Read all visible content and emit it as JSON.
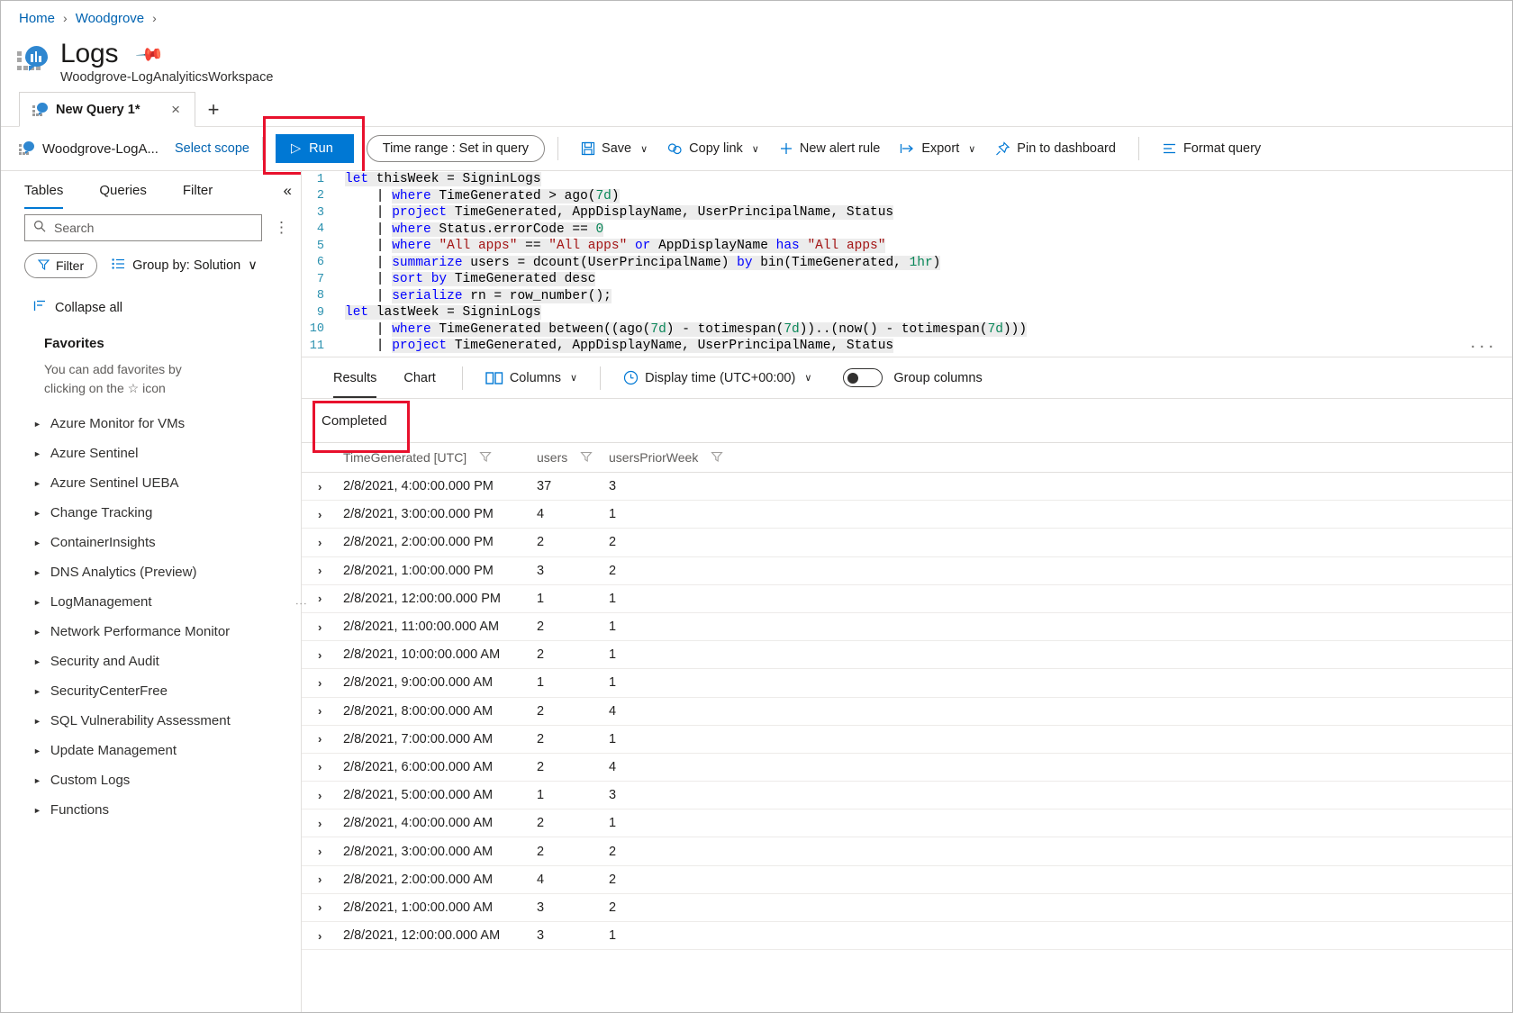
{
  "breadcrumb": {
    "home": "Home",
    "workspace": "Woodgrove",
    "sep": "›"
  },
  "header": {
    "title": "Logs",
    "subtitle": "Woodgrove-LogAnalyiticsWorkspace",
    "pin_icon": "pin-icon"
  },
  "tabs": {
    "query_tab_label": "New Query 1*",
    "close_label": "×",
    "add_label": "+"
  },
  "commandbar": {
    "scope_name": "Woodgrove-LogA...",
    "select_scope": "Select scope",
    "run_label": "Run",
    "run_icon": "play-icon",
    "time_range": "Time range :  Set in query",
    "save": "Save",
    "copy_link": "Copy link",
    "new_alert_rule": "New alert rule",
    "export": "Export",
    "pin_to_dashboard": "Pin to dashboard",
    "format_query": "Format query",
    "chevron": "∨"
  },
  "sidebar": {
    "tabs": [
      {
        "label": "Tables",
        "active": true
      },
      {
        "label": "Queries",
        "active": false
      },
      {
        "label": "Filter",
        "active": false
      }
    ],
    "collapse_chevron": "«",
    "search_placeholder": "Search",
    "filter_label": "Filter",
    "group_by_label": "Group by: Solution",
    "collapse_all": "Collapse all",
    "favorites_heading": "Favorites",
    "favorites_hint_1": "You can add favorites by clicking on",
    "favorites_hint_2": "the",
    "favorites_hint_3": "icon",
    "star_glyph": "☆",
    "solutions": [
      "Azure Monitor for VMs",
      "Azure Sentinel",
      "Azure Sentinel UEBA",
      "Change Tracking",
      "ContainerInsights",
      "DNS Analytics (Preview)",
      "LogManagement",
      "Network Performance Monitor",
      "Security and Audit",
      "SecurityCenterFree",
      "SQL Vulnerability Assessment",
      "Update Management",
      "Custom Logs",
      "Functions"
    ]
  },
  "editor": {
    "ellipsis": "···",
    "lines": [
      {
        "n": "1",
        "text": "let thisWeek = SigninLogs"
      },
      {
        "n": "2",
        "text": "    | where TimeGenerated > ago(7d)"
      },
      {
        "n": "3",
        "text": "    | project TimeGenerated, AppDisplayName, UserPrincipalName, Status"
      },
      {
        "n": "4",
        "text": "    | where Status.errorCode == 0"
      },
      {
        "n": "5",
        "text": "    | where \"All apps\" == \"All apps\" or AppDisplayName has \"All apps\""
      },
      {
        "n": "6",
        "text": "    | summarize users = dcount(UserPrincipalName) by bin(TimeGenerated, 1hr)"
      },
      {
        "n": "7",
        "text": "    | sort by TimeGenerated desc"
      },
      {
        "n": "8",
        "text": "    | serialize rn = row_number();"
      },
      {
        "n": "9",
        "text": "let lastWeek = SigninLogs"
      },
      {
        "n": "10",
        "text": "    | where TimeGenerated between((ago(7d) - totimespan(7d))..(now() - totimespan(7d)))"
      },
      {
        "n": "11",
        "text": "    | project TimeGenerated, AppDisplayName, UserPrincipalName, Status"
      }
    ]
  },
  "results": {
    "tab_results": "Results",
    "tab_chart": "Chart",
    "columns_label": "Columns",
    "display_time_label": "Display time (UTC+00:00)",
    "group_columns_label": "Group columns",
    "chevron": "∨",
    "status": "Completed",
    "columns": [
      "TimeGenerated [UTC]",
      "users",
      "usersPriorWeek"
    ],
    "rows": [
      {
        "time": "2/8/2021, 4:00:00.000 PM",
        "users": "37",
        "prior": "3"
      },
      {
        "time": "2/8/2021, 3:00:00.000 PM",
        "users": "4",
        "prior": "1"
      },
      {
        "time": "2/8/2021, 2:00:00.000 PM",
        "users": "2",
        "prior": "2"
      },
      {
        "time": "2/8/2021, 1:00:00.000 PM",
        "users": "3",
        "prior": "2"
      },
      {
        "time": "2/8/2021, 12:00:00.000 PM",
        "users": "1",
        "prior": "1"
      },
      {
        "time": "2/8/2021, 11:00:00.000 AM",
        "users": "2",
        "prior": "1"
      },
      {
        "time": "2/8/2021, 10:00:00.000 AM",
        "users": "2",
        "prior": "1"
      },
      {
        "time": "2/8/2021, 9:00:00.000 AM",
        "users": "1",
        "prior": "1"
      },
      {
        "time": "2/8/2021, 8:00:00.000 AM",
        "users": "2",
        "prior": "4"
      },
      {
        "time": "2/8/2021, 7:00:00.000 AM",
        "users": "2",
        "prior": "1"
      },
      {
        "time": "2/8/2021, 6:00:00.000 AM",
        "users": "2",
        "prior": "4"
      },
      {
        "time": "2/8/2021, 5:00:00.000 AM",
        "users": "1",
        "prior": "3"
      },
      {
        "time": "2/8/2021, 4:00:00.000 AM",
        "users": "2",
        "prior": "1"
      },
      {
        "time": "2/8/2021, 3:00:00.000 AM",
        "users": "2",
        "prior": "2"
      },
      {
        "time": "2/8/2021, 2:00:00.000 AM",
        "users": "4",
        "prior": "2"
      },
      {
        "time": "2/8/2021, 1:00:00.000 AM",
        "users": "3",
        "prior": "2"
      },
      {
        "time": "2/8/2021, 12:00:00.000 AM",
        "users": "3",
        "prior": "1"
      }
    ],
    "expand_glyph": "›"
  },
  "colors": {
    "accent": "#0078d4",
    "link": "#0063b1",
    "highlight_box": "#e8112d"
  }
}
